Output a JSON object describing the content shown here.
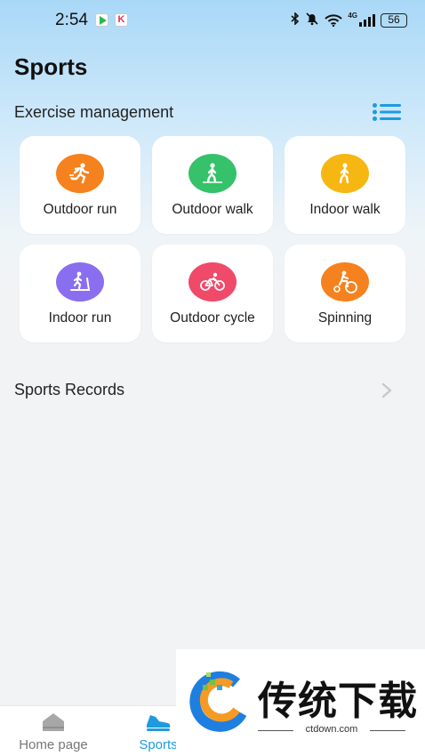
{
  "status_bar": {
    "time": "2:54",
    "battery": "56",
    "network": "4G"
  },
  "page": {
    "title": "Sports"
  },
  "exercise": {
    "title": "Exercise management",
    "items": [
      {
        "label": "Outdoor run",
        "color": "#f5821f",
        "icon": "runner-icon"
      },
      {
        "label": "Outdoor walk",
        "color": "#35c26a",
        "icon": "walker-icon"
      },
      {
        "label": "Indoor walk",
        "color": "#f6b713",
        "icon": "indoor-walk-icon"
      },
      {
        "label": "Indoor run",
        "color": "#8a6ef0",
        "icon": "treadmill-icon"
      },
      {
        "label": "Outdoor cycle",
        "color": "#ef4a6a",
        "icon": "bicycle-icon"
      },
      {
        "label": "Spinning",
        "color": "#f5821f",
        "icon": "spinning-bike-icon"
      }
    ]
  },
  "records": {
    "label": "Sports Records"
  },
  "tabbar": {
    "home": "Home page",
    "sports": "Sports"
  },
  "watermark": {
    "text": "传统下载",
    "site": "ctdown.com"
  },
  "colors": {
    "accent": "#1e9be0"
  }
}
